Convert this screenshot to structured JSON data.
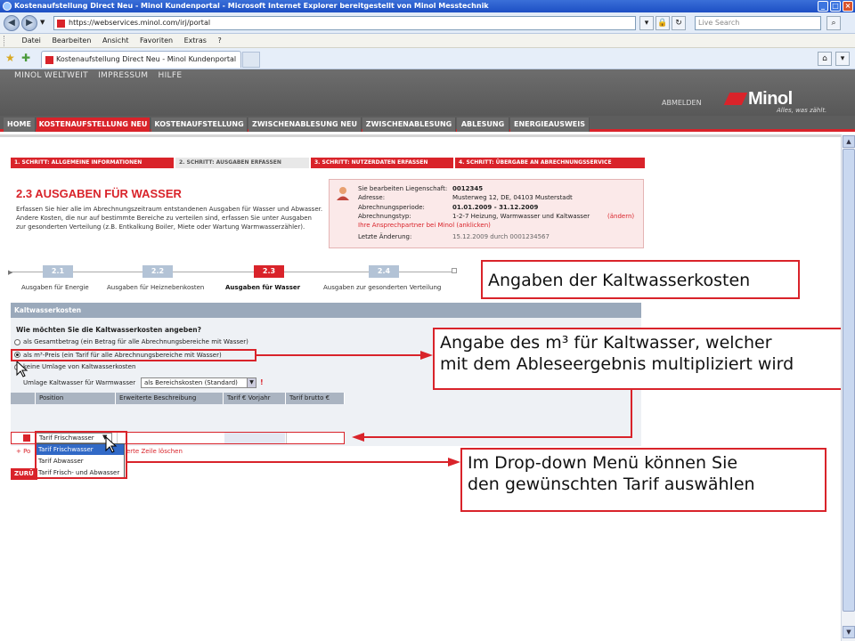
{
  "browser": {
    "window_title": "Kostenaufstellung Direct Neu - Minol Kundenportal - Microsoft Internet Explorer bereitgestellt von Minol Messtechnik",
    "url": "https://webservices.minol.com/irj/portal",
    "search_placeholder": "Live Search",
    "menu": [
      "Datei",
      "Bearbeiten",
      "Ansicht",
      "Favoriten",
      "Extras",
      "?"
    ],
    "tab_title": "Kostenaufstellung Direct Neu - Minol Kundenportal"
  },
  "header": {
    "top_links": [
      "MINOL WELTWEIT",
      "IMPRESSUM",
      "HILFE"
    ],
    "logout": "ABMELDEN",
    "logo": "Minol",
    "slogan": "Alles, was zählt."
  },
  "main_nav": [
    "HOME",
    "KOSTENAUFSTELLUNG NEU",
    "KOSTENAUFSTELLUNG",
    "ZWISCHENABLESUNG NEU",
    "ZWISCHENABLESUNG",
    "ABLESUNG",
    "ENERGIEAUSWEIS"
  ],
  "steps": [
    "1. SCHRITT: ALLGEMEINE INFORMATIONEN",
    "2. SCHRITT: AUSGABEN ERFASSEN",
    "3. SCHRITT: NUTZERDATEN ERFASSEN",
    "4. SCHRITT: ÜBERGABE AN ABRECHNUNGSSERVICE"
  ],
  "page": {
    "title": "2.3 AUSGABEN FÜR WASSER",
    "intro": "Erfassen Sie hier alle im Abrechnungszeitraum entstandenen Ausgaben für Wasser und Abwasser. Andere Kosten, die nur auf bestimmte Bereiche zu verteilen sind, erfassen Sie unter Ausgaben zur gesonderten Verteilung (z.B. Entkalkung Boiler, Miete oder Wartung Warmwasserzähler)."
  },
  "info": {
    "label_property": "Sie bearbeiten Liegenschaft:",
    "property": "0012345",
    "label_address": "Adresse:",
    "address": "Musterweg 12, DE, 04103 Musterstadt",
    "label_period": "Abrechnungsperiode:",
    "period": "01.01.2009 - 31.12.2009",
    "label_type": "Abrechnungstyp:",
    "type": "1-2-7    Heizung, Warmwasser und Kaltwasser",
    "change": "(ändern)",
    "contact": "Ihre Ansprechpartner bei Minol (anklicken)",
    "label_last": "Letzte Änderung:",
    "last": "15.12.2009 durch 0001234567"
  },
  "progress": [
    {
      "num": "2.1",
      "label": "Ausgaben für Energie"
    },
    {
      "num": "2.2",
      "label": "Ausgaben für Heiznebenkosten"
    },
    {
      "num": "2.3",
      "label": "Ausgaben für Wasser"
    },
    {
      "num": "2.4",
      "label": "Ausgaben zur gesonderten Verteilung"
    }
  ],
  "section": {
    "title": "Kaltwasserkosten",
    "question": "Wie möchten Sie die Kaltwasserkosten angeben?",
    "options": [
      "als Gesamtbetrag (ein Betrag für alle Abrechnungsbereiche mit Wasser)",
      "als m³-Preis (ein Tarif für alle Abrechnungsbereiche mit Wasser)",
      "keine Umlage von Kaltwasserkosten"
    ],
    "umlage_label": "Umlage Kaltwasser für Warmwasser",
    "umlage_value": "als Bereichskosten (Standard)"
  },
  "table": {
    "headers": [
      "Position",
      "Erweiterte Beschreibung",
      "Tarif € Vorjahr",
      "Tarif brutto €"
    ],
    "tarif_value": "Tarif Frischwasser",
    "dropdown_options": [
      "Tarif Frischwasser",
      "Tarif Abwasser",
      "Tarif Frisch- und Abwasser"
    ],
    "add_link": "+ Po",
    "delete_link": "erte Zeile löschen",
    "back_button": "ZURÜ"
  },
  "callouts": {
    "c1": "Angaben der Kaltwasserkosten",
    "c2_line1": "Angabe des m³ für Kaltwasser, welcher",
    "c2_line2": "mit dem Ableseergebnis multipliziert wird",
    "c3_line1": "Im Drop-down Menü können Sie",
    "c3_line2": "den gewünschten Tarif auswählen"
  },
  "colors": {
    "accent": "#d9232a",
    "header": "#5d5d5d",
    "progress_inactive": "#b3c3d6"
  }
}
